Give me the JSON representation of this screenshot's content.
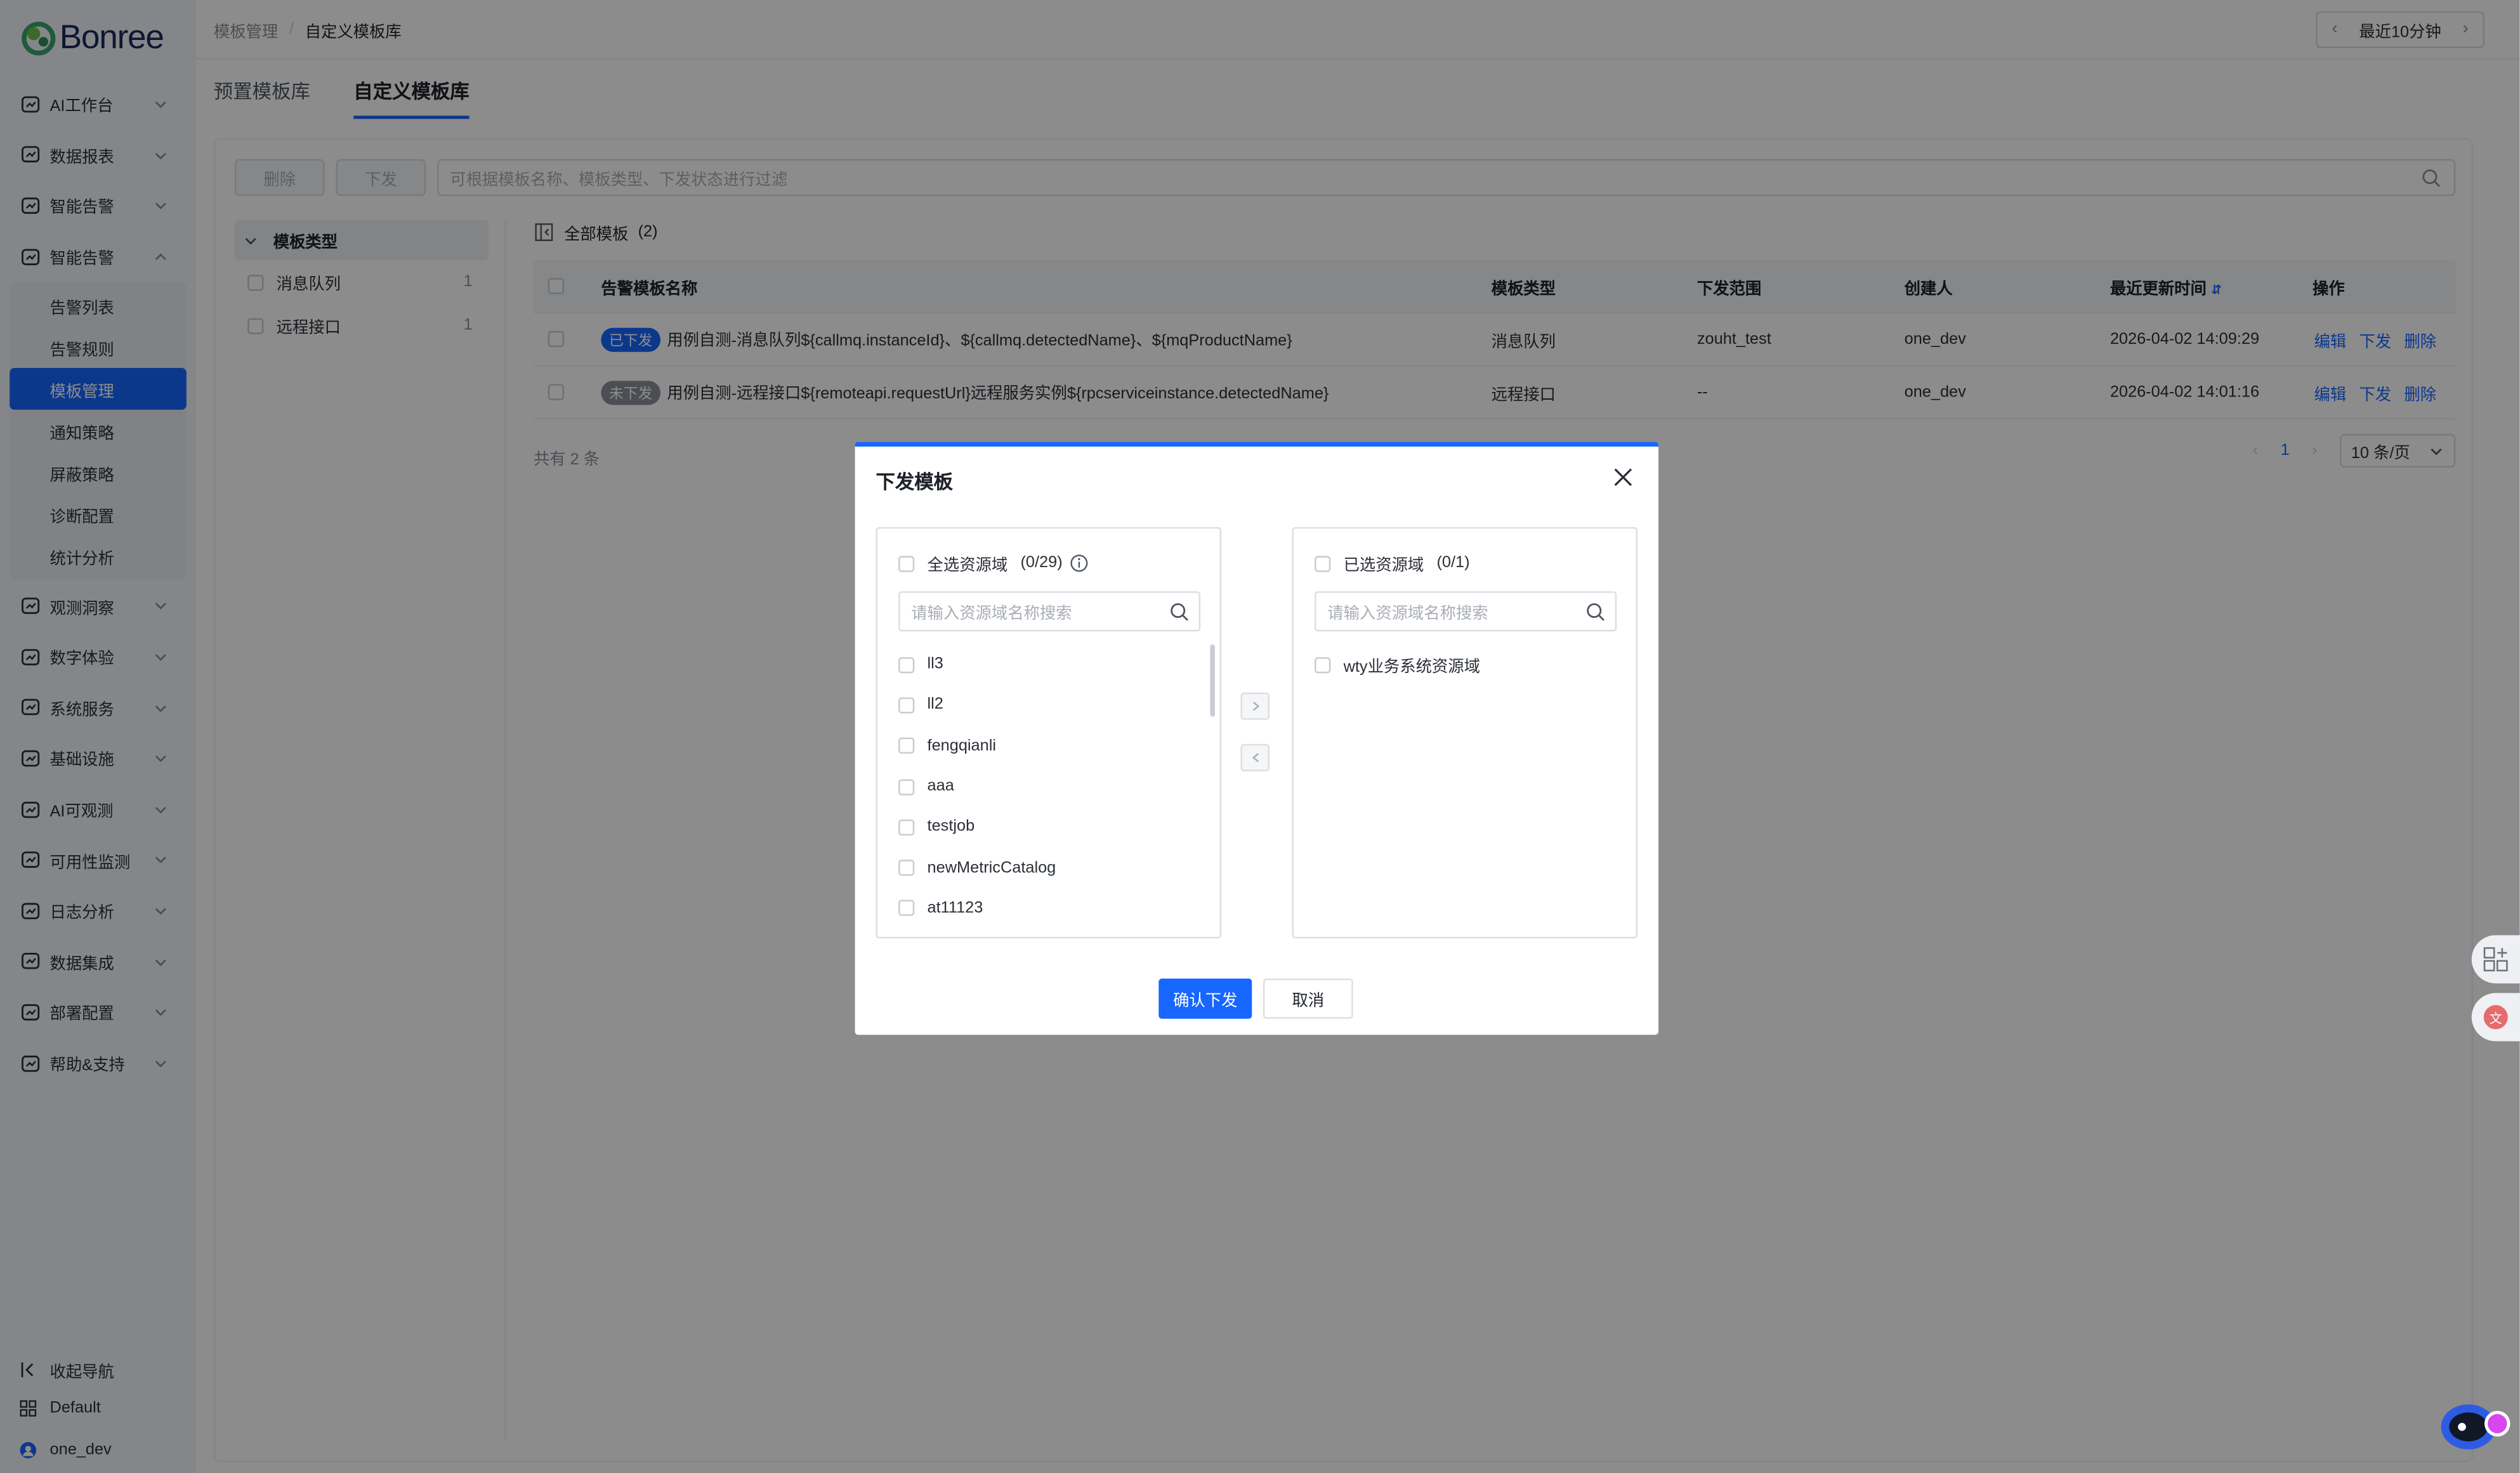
{
  "brand": {
    "name": "Bonree"
  },
  "sidebar": {
    "items": [
      {
        "label": "AI工作台",
        "icon": "ai-workbench-icon"
      },
      {
        "label": "数据报表",
        "icon": "report-icon"
      },
      {
        "label": "智能告警",
        "icon": "alert-icon"
      },
      {
        "label": "智能告警",
        "icon": "alert-icon",
        "expanded": true
      }
    ],
    "sub_items": [
      {
        "label": "告警列表"
      },
      {
        "label": "告警规则"
      },
      {
        "label": "模板管理",
        "active": true
      },
      {
        "label": "通知策略"
      },
      {
        "label": "屏蔽策略"
      },
      {
        "label": "诊断配置"
      },
      {
        "label": "统计分析"
      }
    ],
    "items_after": [
      {
        "label": "观测洞察",
        "icon": "observe-icon"
      },
      {
        "label": "数字体验",
        "icon": "experience-icon"
      },
      {
        "label": "系统服务",
        "icon": "system-service-icon"
      },
      {
        "label": "基础设施",
        "icon": "infrastructure-icon"
      },
      {
        "label": "AI可观测",
        "icon": "ai-observe-icon"
      },
      {
        "label": "可用性监测",
        "icon": "availability-icon"
      },
      {
        "label": "日志分析",
        "icon": "log-icon"
      },
      {
        "label": "数据集成",
        "icon": "integration-icon"
      },
      {
        "label": "部署配置",
        "icon": "deploy-icon"
      },
      {
        "label": "帮助&支持",
        "icon": "help-icon"
      }
    ],
    "collapse_label": "收起导航",
    "workspace_label": "Default",
    "user_label": "one_dev"
  },
  "header": {
    "breadcrumb": [
      "模板管理",
      "自定义模板库"
    ],
    "time_range": "最近10分钟"
  },
  "tabs": [
    {
      "label": "预置模板库",
      "active": false
    },
    {
      "label": "自定义模板库",
      "active": true
    }
  ],
  "toolbar": {
    "delete_label": "删除",
    "issue_label": "下发",
    "filter_placeholder": "可根据模板名称、模板类型、下发状态进行过滤"
  },
  "tree": {
    "title": "模板类型",
    "items": [
      {
        "label": "消息队列",
        "count": "1"
      },
      {
        "label": "远程接口",
        "count": "1"
      }
    ]
  },
  "table": {
    "title": "全部模板",
    "total": "(2)",
    "columns": [
      "告警模板名称",
      "模板类型",
      "下发范围",
      "创建人",
      "最近更新时间",
      "操作"
    ],
    "rows": [
      {
        "status": "已下发",
        "status_color": "#1766ff",
        "name": "用例自测-消息队列${callmq.instanceId}、${callmq.detectedName}、${mqProductName}",
        "type": "消息队列",
        "scope": "zouht_test",
        "creator": "one_dev",
        "updated": "2026-04-02 14:09:29",
        "actions": [
          "编辑",
          "下发",
          "删除"
        ]
      },
      {
        "status": "未下发",
        "status_color": "#8a8f99",
        "name": "用例自测-远程接口${remoteapi.requestUrl}远程服务实例${rpcserviceinstance.detectedName}",
        "type": "远程接口",
        "scope": "--",
        "creator": "one_dev",
        "updated": "2026-04-02 14:01:16",
        "actions": [
          "编辑",
          "下发",
          "删除"
        ]
      }
    ],
    "footer_total": "共有 2 条",
    "page": "1",
    "page_size": "10 条/页"
  },
  "modal": {
    "title": "下发模板",
    "left": {
      "select_all_label": "全选资源域",
      "count": "(0/29)",
      "search_placeholder": "请输入资源域名称搜索",
      "items": [
        "ll3",
        "ll2",
        "fengqianli",
        "aaa",
        "testjob",
        "newMetricCatalog",
        "at11123"
      ]
    },
    "right": {
      "select_all_label": "已选资源域",
      "count": "(0/1)",
      "search_placeholder": "请输入资源域名称搜索",
      "items": [
        "wty业务系统资源域"
      ]
    },
    "confirm_label": "确认下发",
    "cancel_label": "取消"
  },
  "colors": {
    "accent": "#1766ff",
    "sidebar_bg": "#f3f5f9"
  }
}
